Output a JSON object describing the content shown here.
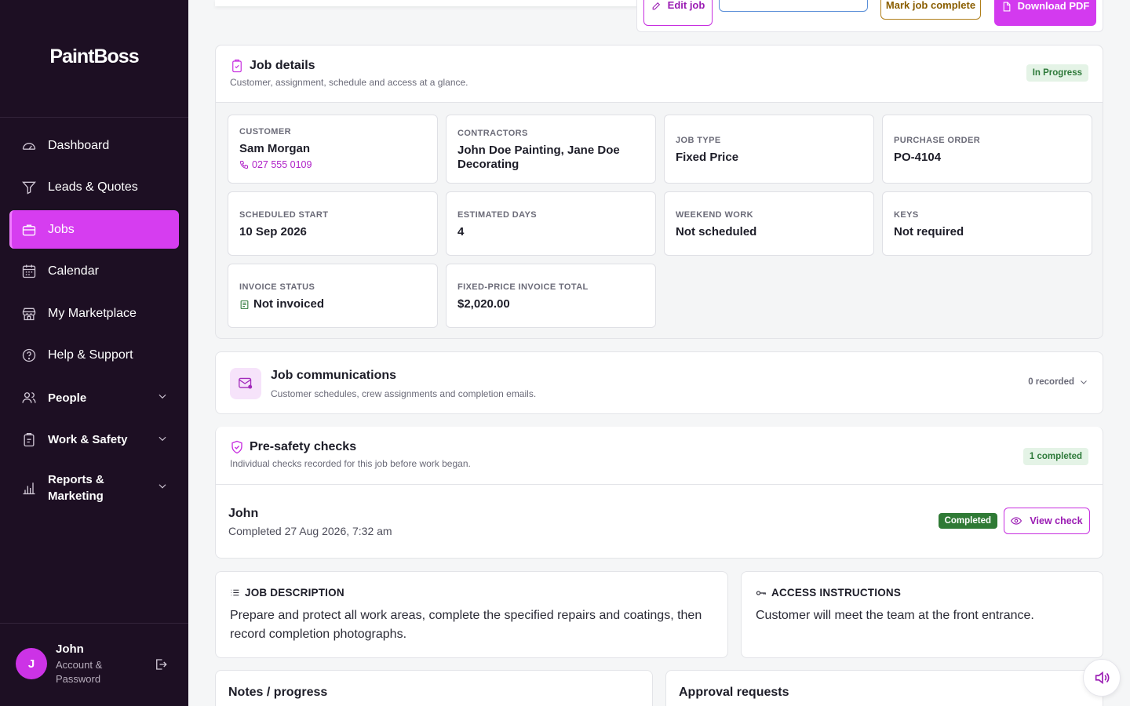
{
  "app": {
    "name": "PaintBoss"
  },
  "sidebar": {
    "items": [
      {
        "label": "Dashboard",
        "icon": "dashboard-gauge-icon"
      },
      {
        "label": "Leads & Quotes",
        "icon": "funnel-icon"
      },
      {
        "label": "Jobs",
        "icon": "briefcase-icon",
        "active": true
      },
      {
        "label": "Calendar",
        "icon": "calendar-icon"
      },
      {
        "label": "My Marketplace",
        "icon": "store-icon"
      },
      {
        "label": "Help & Support",
        "icon": "help-circle-icon"
      }
    ],
    "groups": [
      {
        "label": "People",
        "icon": "people-icon"
      },
      {
        "label": "Work & Safety",
        "icon": "clipboard-icon"
      },
      {
        "label": "Reports & Marketing",
        "icon": "bar-chart-icon"
      }
    ],
    "user": {
      "initial": "J",
      "name": "John",
      "subtitle": "Account & Password"
    }
  },
  "actions": {
    "edit": "Edit job",
    "complete": "Mark job complete",
    "pdf": "Download PDF"
  },
  "job_details": {
    "title": "Job details",
    "subtitle": "Customer, assignment, schedule and access at a glance.",
    "status": "In Progress",
    "customer": {
      "label": "CUSTOMER",
      "value": "Sam Morgan",
      "phone": "027 555 0109"
    },
    "contractors": {
      "label": "CONTRACTORS",
      "value": "John Doe Painting, Jane Doe Decorating"
    },
    "job_type": {
      "label": "JOB TYPE",
      "value": "Fixed Price"
    },
    "purchase_order": {
      "label": "PURCHASE ORDER",
      "value": "PO-4104"
    },
    "scheduled_start": {
      "label": "SCHEDULED START",
      "value": "10 Sep 2026"
    },
    "estimated_days": {
      "label": "ESTIMATED DAYS",
      "value": "4"
    },
    "weekend_work": {
      "label": "WEEKEND WORK",
      "value": "Not scheduled"
    },
    "keys": {
      "label": "KEYS",
      "value": "Not required"
    },
    "invoice_status": {
      "label": "INVOICE STATUS",
      "value": "Not invoiced"
    },
    "invoice_total": {
      "label": "FIXED-PRICE INVOICE TOTAL",
      "value": "$2,020.00"
    }
  },
  "communications": {
    "title": "Job communications",
    "subtitle": "Customer schedules, crew assignments and completion emails.",
    "count": "0 recorded"
  },
  "pre_safety": {
    "title": "Pre-safety checks",
    "subtitle": "Individual checks recorded for this job before work began.",
    "badge": "1 completed",
    "check": {
      "name": "John",
      "date": "Completed 27 Aug 2026, 7:32 am",
      "status": "Completed",
      "action": "View check"
    }
  },
  "description": {
    "heading": "JOB DESCRIPTION",
    "body": "Prepare and protect all work areas, complete the specified repairs and coatings, then record completion photographs."
  },
  "access": {
    "heading": "ACCESS INSTRUCTIONS",
    "body": "Customer will meet the team at the front entrance."
  },
  "notes": {
    "title": "Notes / progress"
  },
  "approvals": {
    "title": "Approval requests"
  },
  "colors": {
    "sidebar_bg": "#1d0f23",
    "accent": "#d63df0",
    "success": "#2f7a35"
  }
}
